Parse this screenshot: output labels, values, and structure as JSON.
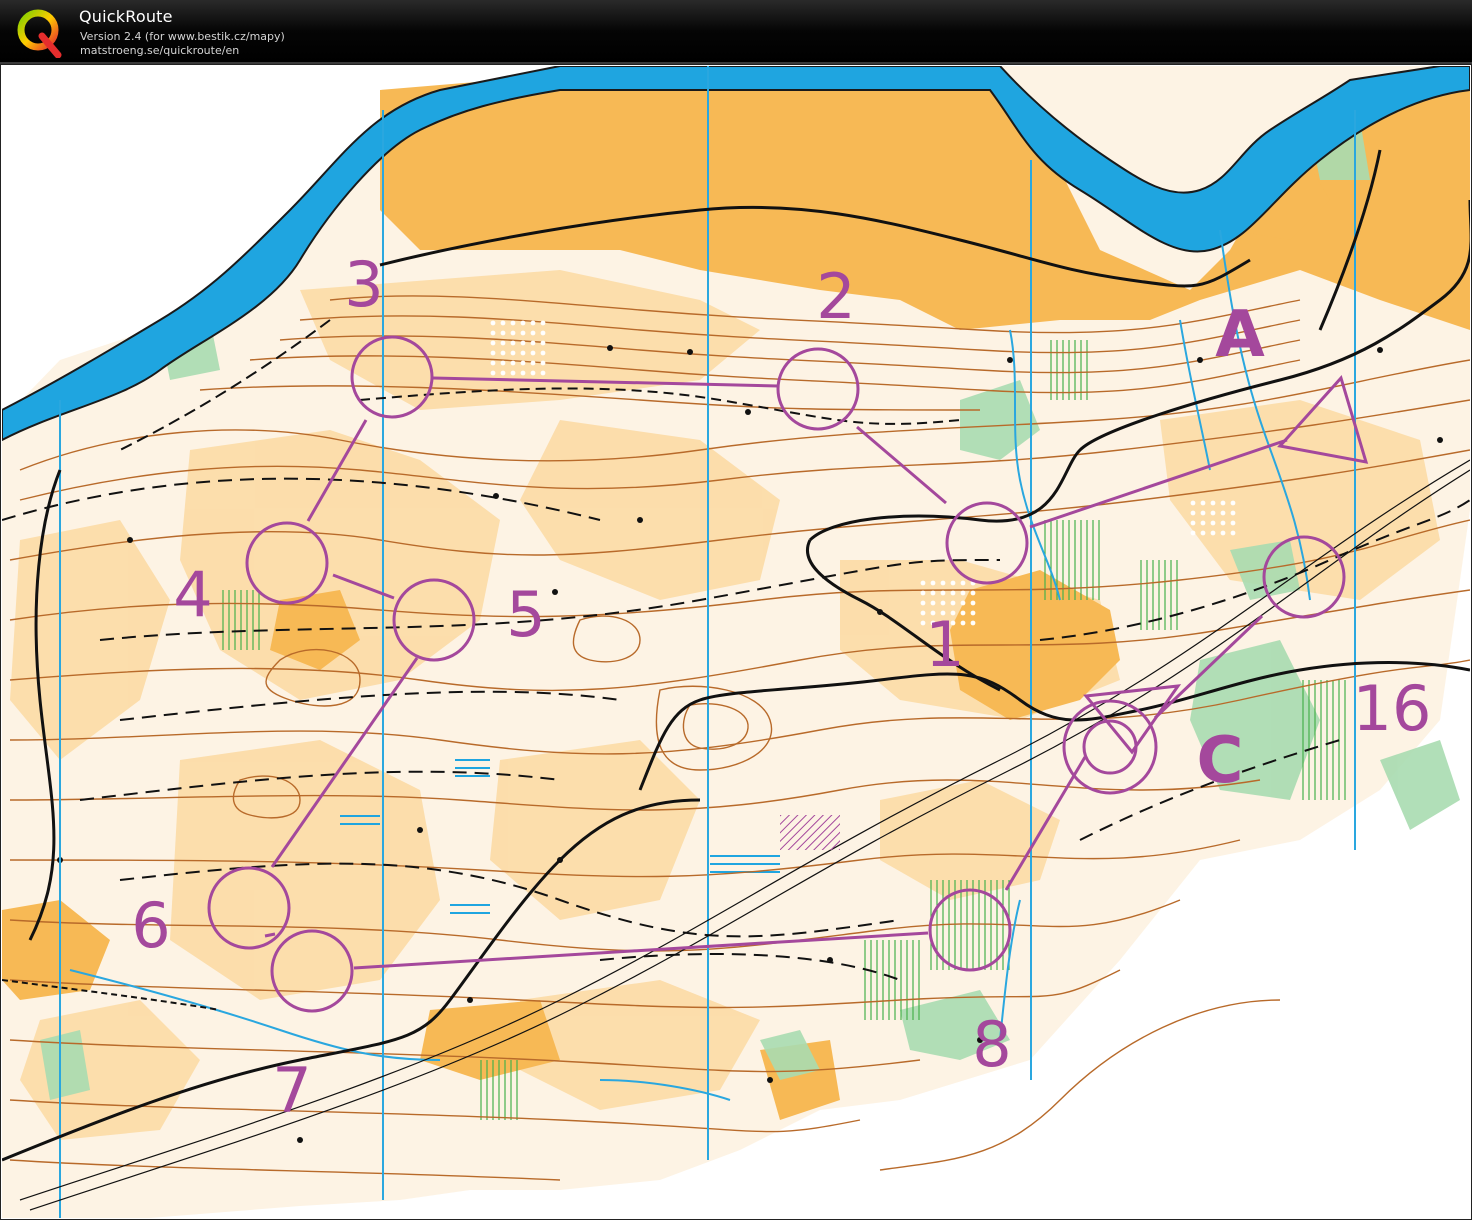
{
  "app": {
    "name": "QuickRoute",
    "version_line": "Version 2.4  (for www.bestik.cz/mapy)",
    "url_line": "matstroeng.se/quickroute/en",
    "logo_letter": "Q"
  },
  "map": {
    "type": "orienteering map",
    "colors": {
      "water": "#1fa5e0",
      "open_land": "#f7b955",
      "rough_open": "#fde0b0",
      "vegetation_green": "#8fcf9a",
      "contour": "#b86a2a",
      "course": "#a4489c",
      "north_lines": "#2aa7df",
      "path": "#111111"
    },
    "controls": [
      {
        "label": "1"
      },
      {
        "label": "2"
      },
      {
        "label": "3"
      },
      {
        "label": "4"
      },
      {
        "label": "5"
      },
      {
        "label": "6"
      },
      {
        "label": "7"
      },
      {
        "label": "8"
      },
      {
        "label": "16"
      }
    ],
    "start_label": "A",
    "extra_label": "C"
  }
}
